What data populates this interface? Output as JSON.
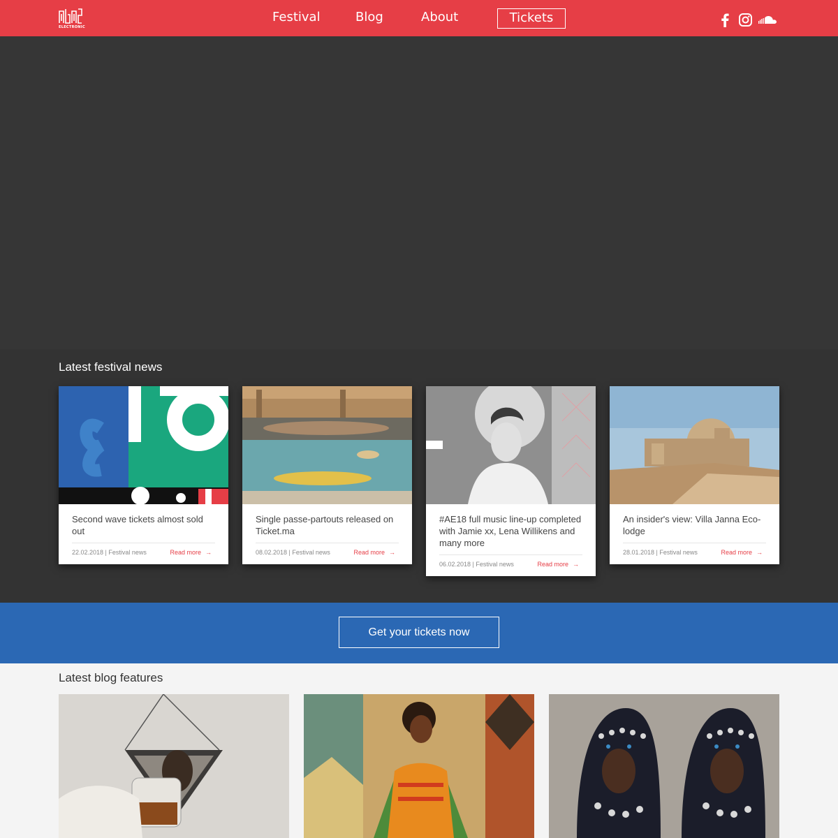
{
  "header": {
    "logo_text": "ELECTRONIC",
    "nav": {
      "festival": "Festival",
      "blog": "Blog",
      "about": "About",
      "tickets": "Tickets"
    },
    "social": [
      "facebook-icon",
      "instagram-icon",
      "soundcloud-icon"
    ],
    "bg_color": "#e63e46"
  },
  "news": {
    "title": "Latest festival news",
    "cards": [
      {
        "title": "Second wave tickets almost sold out",
        "date": "22.02.2018 | Festival news",
        "more": "Read more"
      },
      {
        "title": "Single passe-partouts released on Ticket.ma",
        "date": "08.02.2018 | Festival news",
        "more": "Read more"
      },
      {
        "title": "#AE18 full music line-up completed with Jamie xx, Lena Willikens and many more",
        "date": "06.02.2018 | Festival news",
        "more": "Read more"
      },
      {
        "title": "An insider's view: Villa Janna Eco-lodge",
        "date": "28.01.2018 | Festival news",
        "more": "Read more"
      }
    ]
  },
  "band": {
    "button": "Get your tickets now",
    "color": "#2b68b4"
  },
  "blog": {
    "title": "Latest blog features"
  }
}
